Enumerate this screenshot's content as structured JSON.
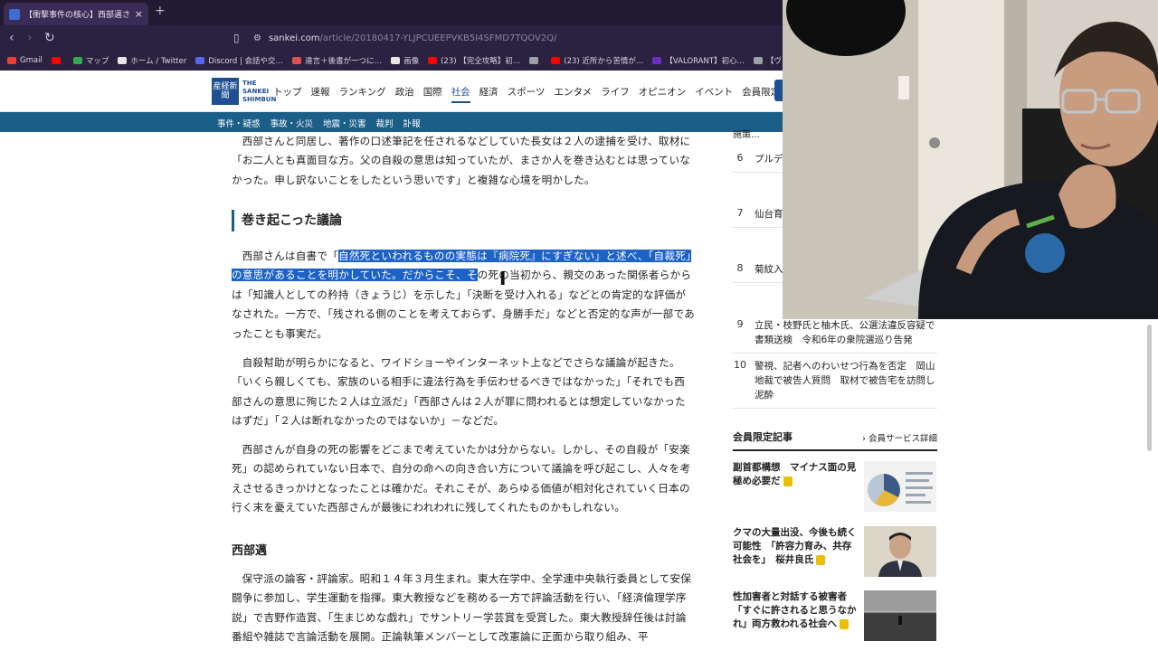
{
  "browser": {
    "tab_title": "【衝撃事件の核心】西部邁さん自殺…",
    "tab_close": "×",
    "new_tab": "+",
    "url_host": "sankei.com",
    "url_path": "/article/20180417-YLJPCUEEPVKB5I4SFMD7TQOV2Q/",
    "bookmarks": [
      {
        "label": "Gmail",
        "color": "#ea4335"
      },
      {
        "label": "",
        "color": "#ff0000"
      },
      {
        "label": "マップ",
        "color": "#34a853"
      },
      {
        "label": "ホーム / Twitter",
        "color": "#e6e6e6"
      },
      {
        "label": "Discord | 会話や交…",
        "color": "#5865f2"
      },
      {
        "label": "違言＋後書が一つに…",
        "color": "#e05050"
      },
      {
        "label": "画像",
        "color": "#e6e6e6"
      },
      {
        "label": "(23) 【完全攻略】初…",
        "color": "#ff0000"
      },
      {
        "label": "",
        "color": "#9aa0a6"
      },
      {
        "label": "(23) 近所から苦情が…",
        "color": "#ff0000"
      },
      {
        "label": "【VALORANT】初心…",
        "color": "#6b2fc4"
      },
      {
        "label": "【ヴァロラント】全マップ…",
        "color": "#9aa0a6"
      }
    ]
  },
  "site": {
    "logo_mark": "産経新聞",
    "logo_line1": "THE",
    "logo_line2": "SANKEI",
    "logo_line3": "SHIMBUN",
    "nav": [
      "トップ",
      "速報",
      "ランキング",
      "政治",
      "国際",
      "社会",
      "経済",
      "スポーツ",
      "エンタメ",
      "ライフ",
      "オピニオン",
      "イベント",
      "会員限定記事"
    ],
    "nav_active": "社会",
    "subnav": [
      "事件・疑惑",
      "事故・火災",
      "地震・災害",
      "裁判",
      "訃報"
    ]
  },
  "article": {
    "p1": "西部さんと同居し、著作の口述筆記を任されるなどしていた長女は２人の逮捕を受け、取材に「お二人とも真面目な方。父の自殺の意思は知っていたが、まさか人を巻き込むとは思っていなかった。申し訳ないことをしたという思いです」と複雑な心境を明かした。",
    "h2": "巻き起こった議論",
    "p2_pre": "西部さんは自書で「",
    "p2_hl": "自然死といわれるものの実態は『病院死』にすぎない」と述べ、「自裁死」の意思があることを明かしていた。だからこそ、そ",
    "p2_post": "の死の当初から、親交のあった関係者らからは「知識人としての矜持（きょうじ）を示した」「決断を受け入れる」などとの肯定的な評価がなされた。一方で、「残される側のことを考えておらず、身勝手だ」などと否定的な声が一部であったことも事実だ。",
    "p3": "自殺幇助が明らかになると、ワイドショーやインターネット上などでさらな議論が起きた。「いくら親しくても、家族のいる相手に違法行為を手伝わせるべきではなかった」「それでも西部さんの意思に殉じた２人は立派だ」「西部さんは２人が罪に問われるとは想定していなかったはずだ」「２人は断れなかったのではないか」－などだ。",
    "p4": "西部さんが自身の死の影響をどこまで考えていたかは分からない。しかし、その自殺が「安楽死」の認められていない日本で、自分の命への向き合い方について議論を呼び起こし、人々を考えさせるきっかけとなったことは確かだ。それこそが、あらゆる価値が相対化されていく日本の行く末を憂えていた西部さんが最後にわれわれに残してくれたものかもしれない。",
    "h3": "西部邁",
    "p5": "保守派の論客・評論家。昭和１４年３月生まれ。東大在学中、全学連中央執行委員として安保闘争に参加し、学生運動を指揮。東大教授などを務める一方で評論活動を行い、「経済倫理学序説」で吉野作造賞、「生まじめな戯れ」でサントリー学芸賞を受賞した。東大教授辞任後は討論番組や雑誌で言論活動を展開。正論執筆メンバーとして改憲論に正面から取り組み、平"
  },
  "sidebar": {
    "top_fragment": "施策…",
    "ranking": [
      {
        "num": "6",
        "text": "プルデ…顧客被…へ"
      },
      {
        "num": "7",
        "text": "仙台育…一部、…への出…"
      },
      {
        "num": "8",
        "text": "菊紋入…効果期…「なぜ…"
      },
      {
        "num": "9",
        "text": "立民・枝野氏と柚木氏、公選法違反容疑で書類送検　令和6年の衆院選巡り告発"
      },
      {
        "num": "10",
        "text": "警視、記者へのわいせつ行為を否定　岡山地裁で被告人質問　取材で被告宅を訪問し泥酔"
      }
    ],
    "members_title": "会員限定記事",
    "members_more": "› 会員サービス詳細",
    "cards": [
      {
        "title": "副首都構想　マイナス面の見極め必要だ"
      },
      {
        "title": "クマの大量出没、今後も続く可能性　「許容力育み、共存社会を」　桜井良氏"
      },
      {
        "title": "性加害者と対話する被害者「すぐに許されると思うなかれ」両方救われる社会へ"
      }
    ]
  },
  "icons": {
    "back": "back-arrow-icon",
    "forward": "forward-arrow-icon",
    "reload": "reload-icon",
    "bookmark": "bookmark-icon",
    "site_settings": "site-settings-icon",
    "cursor": "text-cursor-icon"
  }
}
